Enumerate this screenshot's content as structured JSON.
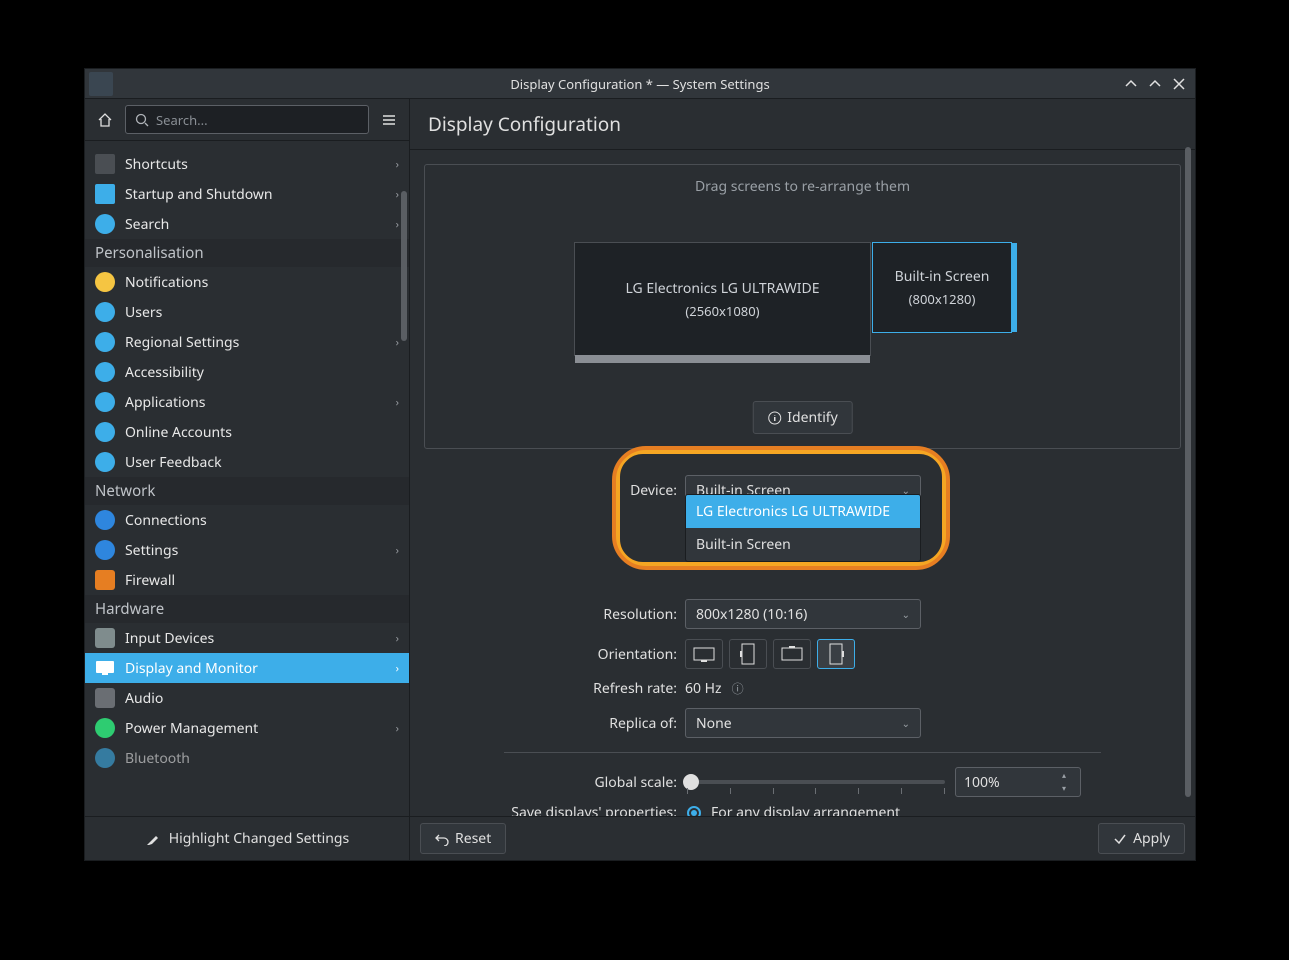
{
  "window": {
    "title": "Display Configuration * — System Settings"
  },
  "sidebar": {
    "search_placeholder": "Search...",
    "categories": [
      {
        "name": "",
        "items": [
          {
            "label": "Shortcuts",
            "icon": "keyboard-icon",
            "chevron": true
          },
          {
            "label": "Startup and Shutdown",
            "icon": "monitor-icon",
            "chevron": true
          },
          {
            "label": "Search",
            "icon": "search-circle-icon",
            "chevron": true
          }
        ]
      },
      {
        "name": "Personalisation",
        "items": [
          {
            "label": "Notifications",
            "icon": "bell-icon",
            "chevron": false
          },
          {
            "label": "Users",
            "icon": "user-icon",
            "chevron": false
          },
          {
            "label": "Regional Settings",
            "icon": "flag-icon",
            "chevron": true
          },
          {
            "label": "Accessibility",
            "icon": "accessibility-icon",
            "chevron": false
          },
          {
            "label": "Applications",
            "icon": "apps-icon",
            "chevron": true
          },
          {
            "label": "Online Accounts",
            "icon": "cloud-account-icon",
            "chevron": false
          },
          {
            "label": "User Feedback",
            "icon": "feedback-icon",
            "chevron": false
          }
        ]
      },
      {
        "name": "Network",
        "items": [
          {
            "label": "Connections",
            "icon": "globe-icon",
            "chevron": false
          },
          {
            "label": "Settings",
            "icon": "globe-icon",
            "chevron": true
          },
          {
            "label": "Firewall",
            "icon": "firewall-icon",
            "chevron": false
          }
        ]
      },
      {
        "name": "Hardware",
        "items": [
          {
            "label": "Input Devices",
            "icon": "mouse-icon",
            "chevron": true
          },
          {
            "label": "Display and Monitor",
            "icon": "display-icon",
            "chevron": true,
            "selected": true
          },
          {
            "label": "Audio",
            "icon": "speaker-icon",
            "chevron": false
          },
          {
            "label": "Power Management",
            "icon": "power-icon",
            "chevron": true
          },
          {
            "label": "Bluetooth",
            "icon": "bluetooth-icon",
            "chevron": false
          }
        ]
      }
    ],
    "highlight_changed": "Highlight Changed Settings"
  },
  "main": {
    "title": "Display Configuration",
    "arrange_hint": "Drag screens to re-arrange them",
    "screens": [
      {
        "name": "LG Electronics LG ULTRAWIDE",
        "res": "(2560x1080)",
        "primary": true
      },
      {
        "name": "Built-in Screen",
        "res": "(800x1280)",
        "active": true
      }
    ],
    "identify": "Identify",
    "form": {
      "device_label": "Device:",
      "device_value": "Built-in Screen",
      "device_options": [
        "LG Electronics LG ULTRAWIDE",
        "Built-in Screen"
      ],
      "resolution_label": "Resolution:",
      "resolution_value": "800x1280 (10:16)",
      "orientation_label": "Orientation:",
      "refresh_label": "Refresh rate:",
      "refresh_value": "60 Hz",
      "replica_label": "Replica of:",
      "replica_value": "None",
      "scale_label": "Global scale:",
      "scale_value": "100%",
      "save_label": "Save displays' properties:",
      "save_option": "For any display arrangement"
    },
    "buttons": {
      "reset": "Reset",
      "apply": "Apply"
    }
  }
}
